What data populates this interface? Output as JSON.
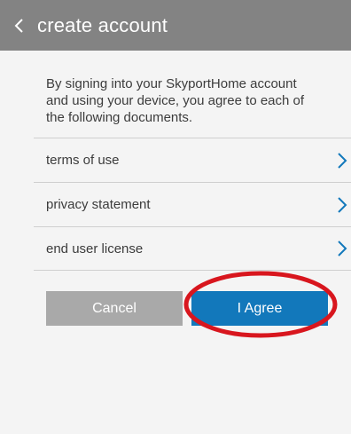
{
  "header": {
    "back_icon": "chevron-left-icon",
    "title": "create account"
  },
  "intro_text": "By signing into your SkyportHome account and using your device, you agree to each of the following documents.",
  "documents": [
    {
      "label": "terms of use",
      "icon": "chevron-right-icon"
    },
    {
      "label": "privacy statement",
      "icon": "chevron-right-icon"
    },
    {
      "label": "end user license",
      "icon": "chevron-right-icon"
    }
  ],
  "buttons": {
    "cancel_label": "Cancel",
    "agree_label": "I Agree"
  },
  "colors": {
    "header_bg": "#838383",
    "page_bg": "#f4f4f4",
    "chevron": "#1278bb",
    "cancel_bg": "#a9a9a9",
    "agree_bg": "#1278bb",
    "annotation": "#d8161e"
  }
}
